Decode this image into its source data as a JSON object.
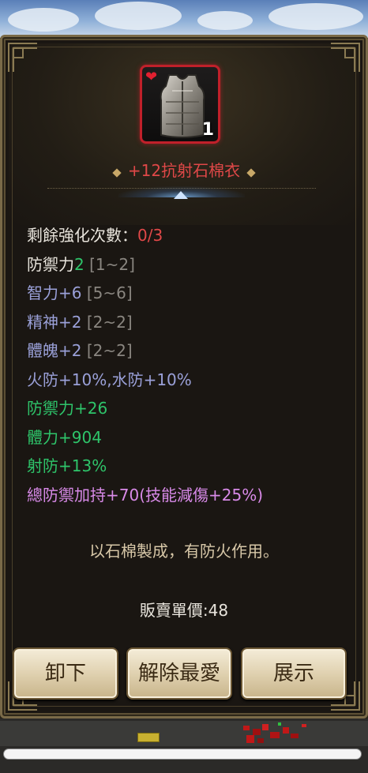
{
  "item": {
    "name": "+12抗射石棉衣",
    "count": "1",
    "icon": "armor-vest-icon",
    "favorite_icon": "heart-icon",
    "frame_color": "#c0202a"
  },
  "stats": [
    {
      "parts": [
        {
          "text": "剩餘強化次數：",
          "cls": "c-white"
        },
        {
          "text": "0/3",
          "cls": "c-red"
        }
      ]
    },
    {
      "parts": [
        {
          "text": "防禦力",
          "cls": "c-white"
        },
        {
          "text": "2",
          "cls": "c-green"
        },
        {
          "text": " [1~2]",
          "cls": "c-gray"
        }
      ]
    },
    {
      "parts": [
        {
          "text": "智力+6",
          "cls": "c-blue"
        },
        {
          "text": " [5~6]",
          "cls": "c-gray"
        }
      ]
    },
    {
      "parts": [
        {
          "text": "精神+2",
          "cls": "c-blue"
        },
        {
          "text": " [2~2]",
          "cls": "c-gray"
        }
      ]
    },
    {
      "parts": [
        {
          "text": "體魄+2",
          "cls": "c-blue"
        },
        {
          "text": " [2~2]",
          "cls": "c-gray"
        }
      ]
    },
    {
      "parts": [
        {
          "text": "火防+10%,水防+10%",
          "cls": "c-blue"
        }
      ]
    },
    {
      "parts": [
        {
          "text": "防禦力+26",
          "cls": "c-green"
        }
      ]
    },
    {
      "parts": [
        {
          "text": "體力+904",
          "cls": "c-green"
        }
      ]
    },
    {
      "parts": [
        {
          "text": "射防+13%",
          "cls": "c-green"
        }
      ]
    },
    {
      "parts": [
        {
          "text": "總防禦加持+70(技能減傷+25%)",
          "cls": "c-purple"
        }
      ]
    }
  ],
  "description": "以石棉製成，有防火作用。",
  "price_label": "販賣單價:48",
  "buttons": {
    "unequip": "卸下",
    "unfavorite": "解除最愛",
    "show": "展示"
  },
  "colors": {
    "accent_red": "#e04848",
    "stat_blue": "#9aa0d8",
    "stat_green": "#2ec46a",
    "stat_purple": "#d88ae8",
    "stat_gray": "#8a8680"
  }
}
